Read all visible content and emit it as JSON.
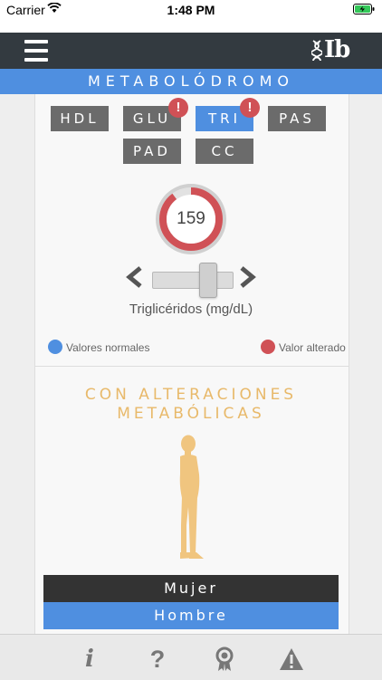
{
  "status_bar": {
    "carrier": "Carrier",
    "time": "1:48 PM"
  },
  "header": {
    "logo_text": "Ib",
    "nav_color": "#333a40"
  },
  "banner": {
    "title": "METABOLÓDROMO",
    "color": "#4f8fe0"
  },
  "chips": [
    {
      "label": "HDL",
      "selected": false,
      "alert": false
    },
    {
      "label": "GLU",
      "selected": false,
      "alert": true
    },
    {
      "label": "TRI",
      "selected": true,
      "alert": true
    },
    {
      "label": "PAS",
      "selected": false,
      "alert": false
    },
    {
      "label": "PAD",
      "selected": false,
      "alert": false
    },
    {
      "label": "CC",
      "selected": false,
      "alert": false
    }
  ],
  "alert_mark": "!",
  "gauge": {
    "value": "159",
    "ring_color": "#d05156"
  },
  "slider": {
    "label": "Triglicéridos (mg/dL)"
  },
  "legend": {
    "normal": {
      "label": "Valores normales",
      "color": "#4f8fe0"
    },
    "altered": {
      "label": "Valor alterado",
      "color": "#d05156"
    }
  },
  "section": {
    "title_line1": "CON ALTERACIONES",
    "title_line2": "METABÓLICAS",
    "title_color": "#e8b96a"
  },
  "sex_selector": {
    "female": "Mujer",
    "male": "Hombre",
    "selected": "Hombre"
  },
  "tabbar": {
    "items": [
      "info-icon",
      "help-icon",
      "award-icon",
      "warning-icon"
    ],
    "info_glyph": "i",
    "help_glyph": "?"
  }
}
